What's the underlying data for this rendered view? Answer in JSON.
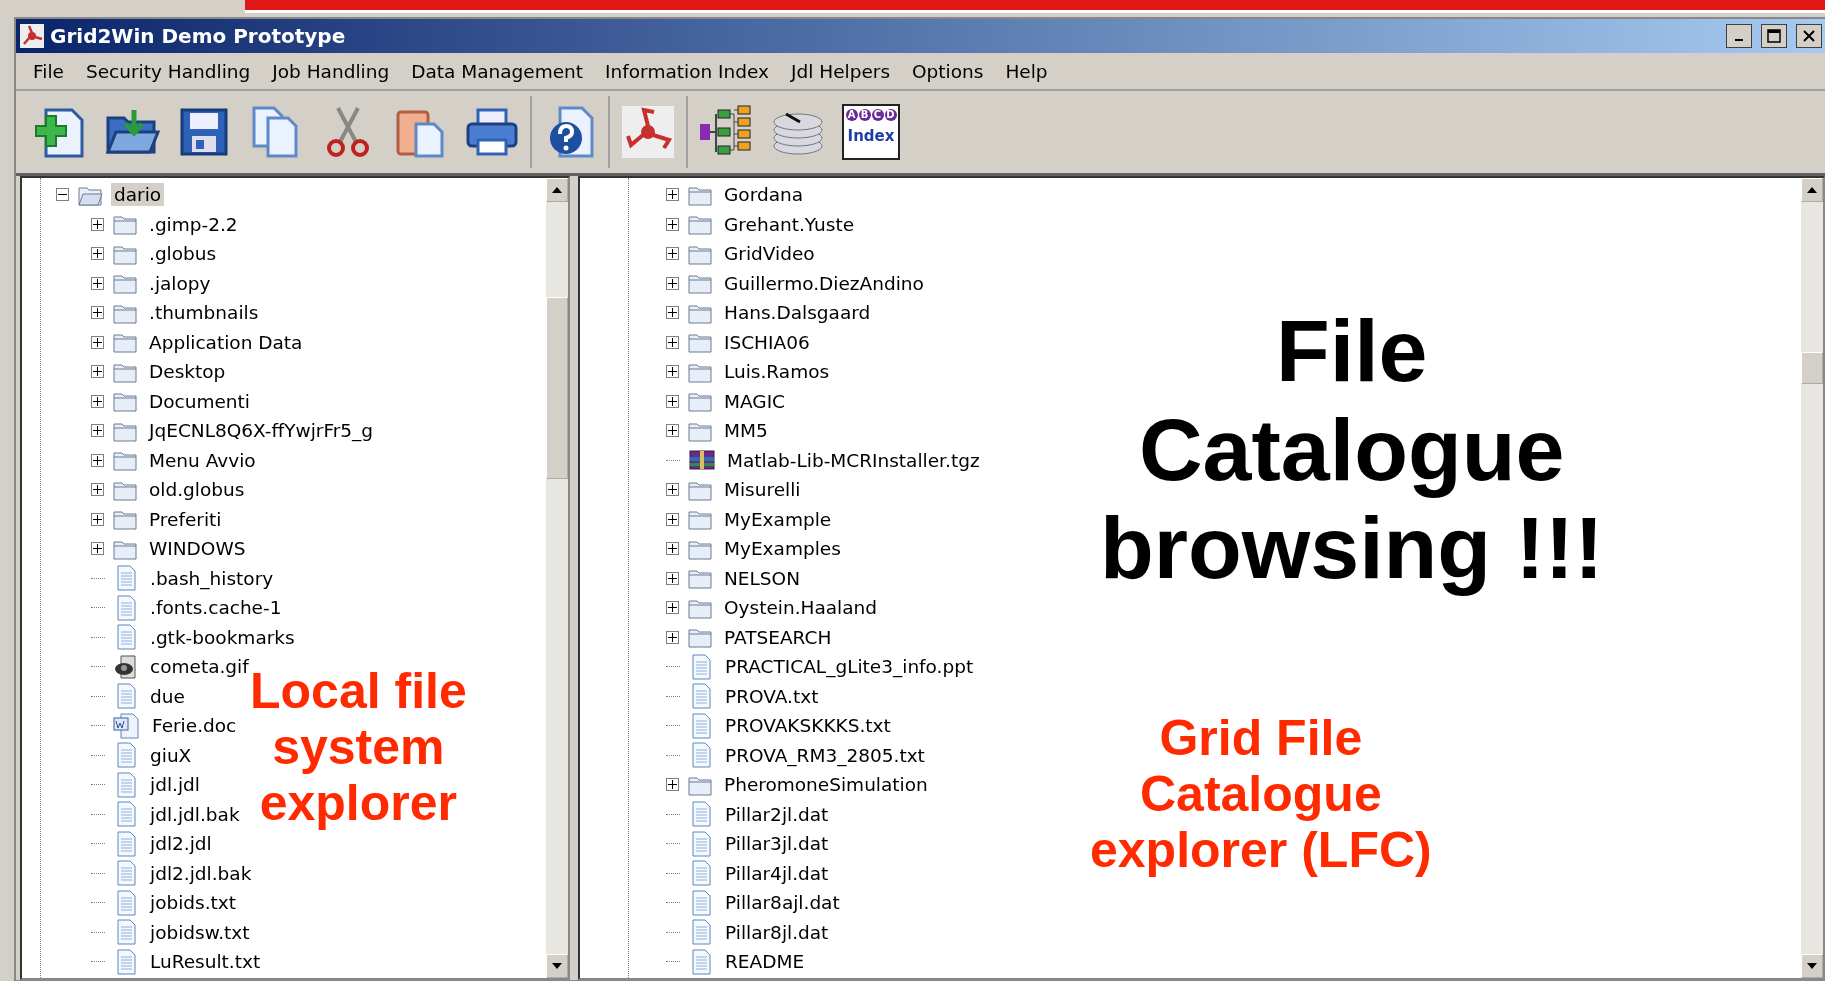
{
  "window": {
    "title": "Grid2Win Demo Prototype"
  },
  "menu": [
    "File",
    "Security Handling",
    "Job Handling",
    "Data Management",
    "Information Index",
    "Jdl Helpers",
    "Options",
    "Help"
  ],
  "toolbar": [
    [
      {
        "kind": "new"
      },
      {
        "kind": "open"
      },
      {
        "kind": "save"
      },
      {
        "kind": "copy"
      },
      {
        "kind": "cut"
      },
      {
        "kind": "paste"
      },
      {
        "kind": "print"
      }
    ],
    [
      {
        "kind": "help"
      }
    ],
    [
      {
        "kind": "logo"
      }
    ],
    [
      {
        "kind": "tree"
      },
      {
        "kind": "disk"
      },
      {
        "kind": "index",
        "label": "Index",
        "letters": [
          "A",
          "B",
          "C",
          "D"
        ]
      }
    ]
  ],
  "local_tree": [
    {
      "name": "dario",
      "kind": "folder",
      "expanded": true,
      "selected": true,
      "children": [
        {
          "name": ".gimp-2.2",
          "kind": "folder",
          "expanded": false
        },
        {
          "name": ".globus",
          "kind": "folder",
          "expanded": false
        },
        {
          "name": ".jalopy",
          "kind": "folder",
          "expanded": false
        },
        {
          "name": ".thumbnails",
          "kind": "folder",
          "expanded": false
        },
        {
          "name": "Application Data",
          "kind": "folder",
          "expanded": false
        },
        {
          "name": "Desktop",
          "kind": "folder",
          "expanded": false
        },
        {
          "name": "Documenti",
          "kind": "folder",
          "expanded": false
        },
        {
          "name": "JqECNL8Q6X-ffYwjrFr5_g",
          "kind": "folder",
          "expanded": false
        },
        {
          "name": "Menu Avvio",
          "kind": "folder",
          "expanded": false
        },
        {
          "name": "old.globus",
          "kind": "folder",
          "expanded": false
        },
        {
          "name": "Preferiti",
          "kind": "folder",
          "expanded": false
        },
        {
          "name": "WINDOWS",
          "kind": "folder",
          "expanded": false
        },
        {
          "name": ".bash_history",
          "kind": "file"
        },
        {
          "name": ".fonts.cache-1",
          "kind": "file"
        },
        {
          "name": ".gtk-bookmarks",
          "kind": "file"
        },
        {
          "name": "cometa.gif",
          "kind": "image"
        },
        {
          "name": "due",
          "kind": "file"
        },
        {
          "name": "Ferie.doc",
          "kind": "doc"
        },
        {
          "name": "giuX",
          "kind": "file"
        },
        {
          "name": "jdl.jdl",
          "kind": "file"
        },
        {
          "name": "jdl.jdl.bak",
          "kind": "file"
        },
        {
          "name": "jdl2.jdl",
          "kind": "file"
        },
        {
          "name": "jdl2.jdl.bak",
          "kind": "file"
        },
        {
          "name": "jobids.txt",
          "kind": "file"
        },
        {
          "name": "jobidsw.txt",
          "kind": "file"
        },
        {
          "name": "LuResult.txt",
          "kind": "file"
        }
      ]
    }
  ],
  "grid_tree": [
    {
      "name": "Gordana",
      "kind": "folder",
      "expanded": false
    },
    {
      "name": "Grehant.Yuste",
      "kind": "folder",
      "expanded": false
    },
    {
      "name": "GridVideo",
      "kind": "folder",
      "expanded": false
    },
    {
      "name": "Guillermo.DiezAndino",
      "kind": "folder",
      "expanded": false
    },
    {
      "name": "Hans.Dalsgaard",
      "kind": "folder",
      "expanded": false
    },
    {
      "name": "ISCHIA06",
      "kind": "folder",
      "expanded": false
    },
    {
      "name": "Luis.Ramos",
      "kind": "folder",
      "expanded": false
    },
    {
      "name": "MAGIC",
      "kind": "folder",
      "expanded": false
    },
    {
      "name": "MM5",
      "kind": "folder",
      "expanded": false
    },
    {
      "name": "Matlab-Lib-MCRInstaller.tgz",
      "kind": "archive"
    },
    {
      "name": "Misurelli",
      "kind": "folder",
      "expanded": false
    },
    {
      "name": "MyExample",
      "kind": "folder",
      "expanded": false
    },
    {
      "name": "MyExamples",
      "kind": "folder",
      "expanded": false
    },
    {
      "name": "NELSON",
      "kind": "folder",
      "expanded": false
    },
    {
      "name": "Oystein.Haaland",
      "kind": "folder",
      "expanded": false
    },
    {
      "name": "PATSEARCH",
      "kind": "folder",
      "expanded": false
    },
    {
      "name": "PRACTICAL_gLite3_info.ppt",
      "kind": "file"
    },
    {
      "name": "PROVA.txt",
      "kind": "file"
    },
    {
      "name": "PROVAKSKKKS.txt",
      "kind": "file"
    },
    {
      "name": "PROVA_RM3_2805.txt",
      "kind": "file"
    },
    {
      "name": "PheromoneSimulation",
      "kind": "folder",
      "expanded": false
    },
    {
      "name": "Pillar2jl.dat",
      "kind": "file"
    },
    {
      "name": "Pillar3jl.dat",
      "kind": "file"
    },
    {
      "name": "Pillar4jl.dat",
      "kind": "file"
    },
    {
      "name": "Pillar8ajl.dat",
      "kind": "file"
    },
    {
      "name": "Pillar8jl.dat",
      "kind": "file"
    },
    {
      "name": "README",
      "kind": "file"
    }
  ],
  "annotations": [
    {
      "kind": "local",
      "lines": [
        "Local file",
        "system",
        "explorer"
      ]
    },
    {
      "kind": "headline",
      "lines": [
        "File",
        "Catalogue",
        "browsing !!!"
      ]
    },
    {
      "kind": "grid",
      "lines": [
        "Grid File",
        "Catalogue",
        "explorer (LFC)"
      ]
    }
  ]
}
